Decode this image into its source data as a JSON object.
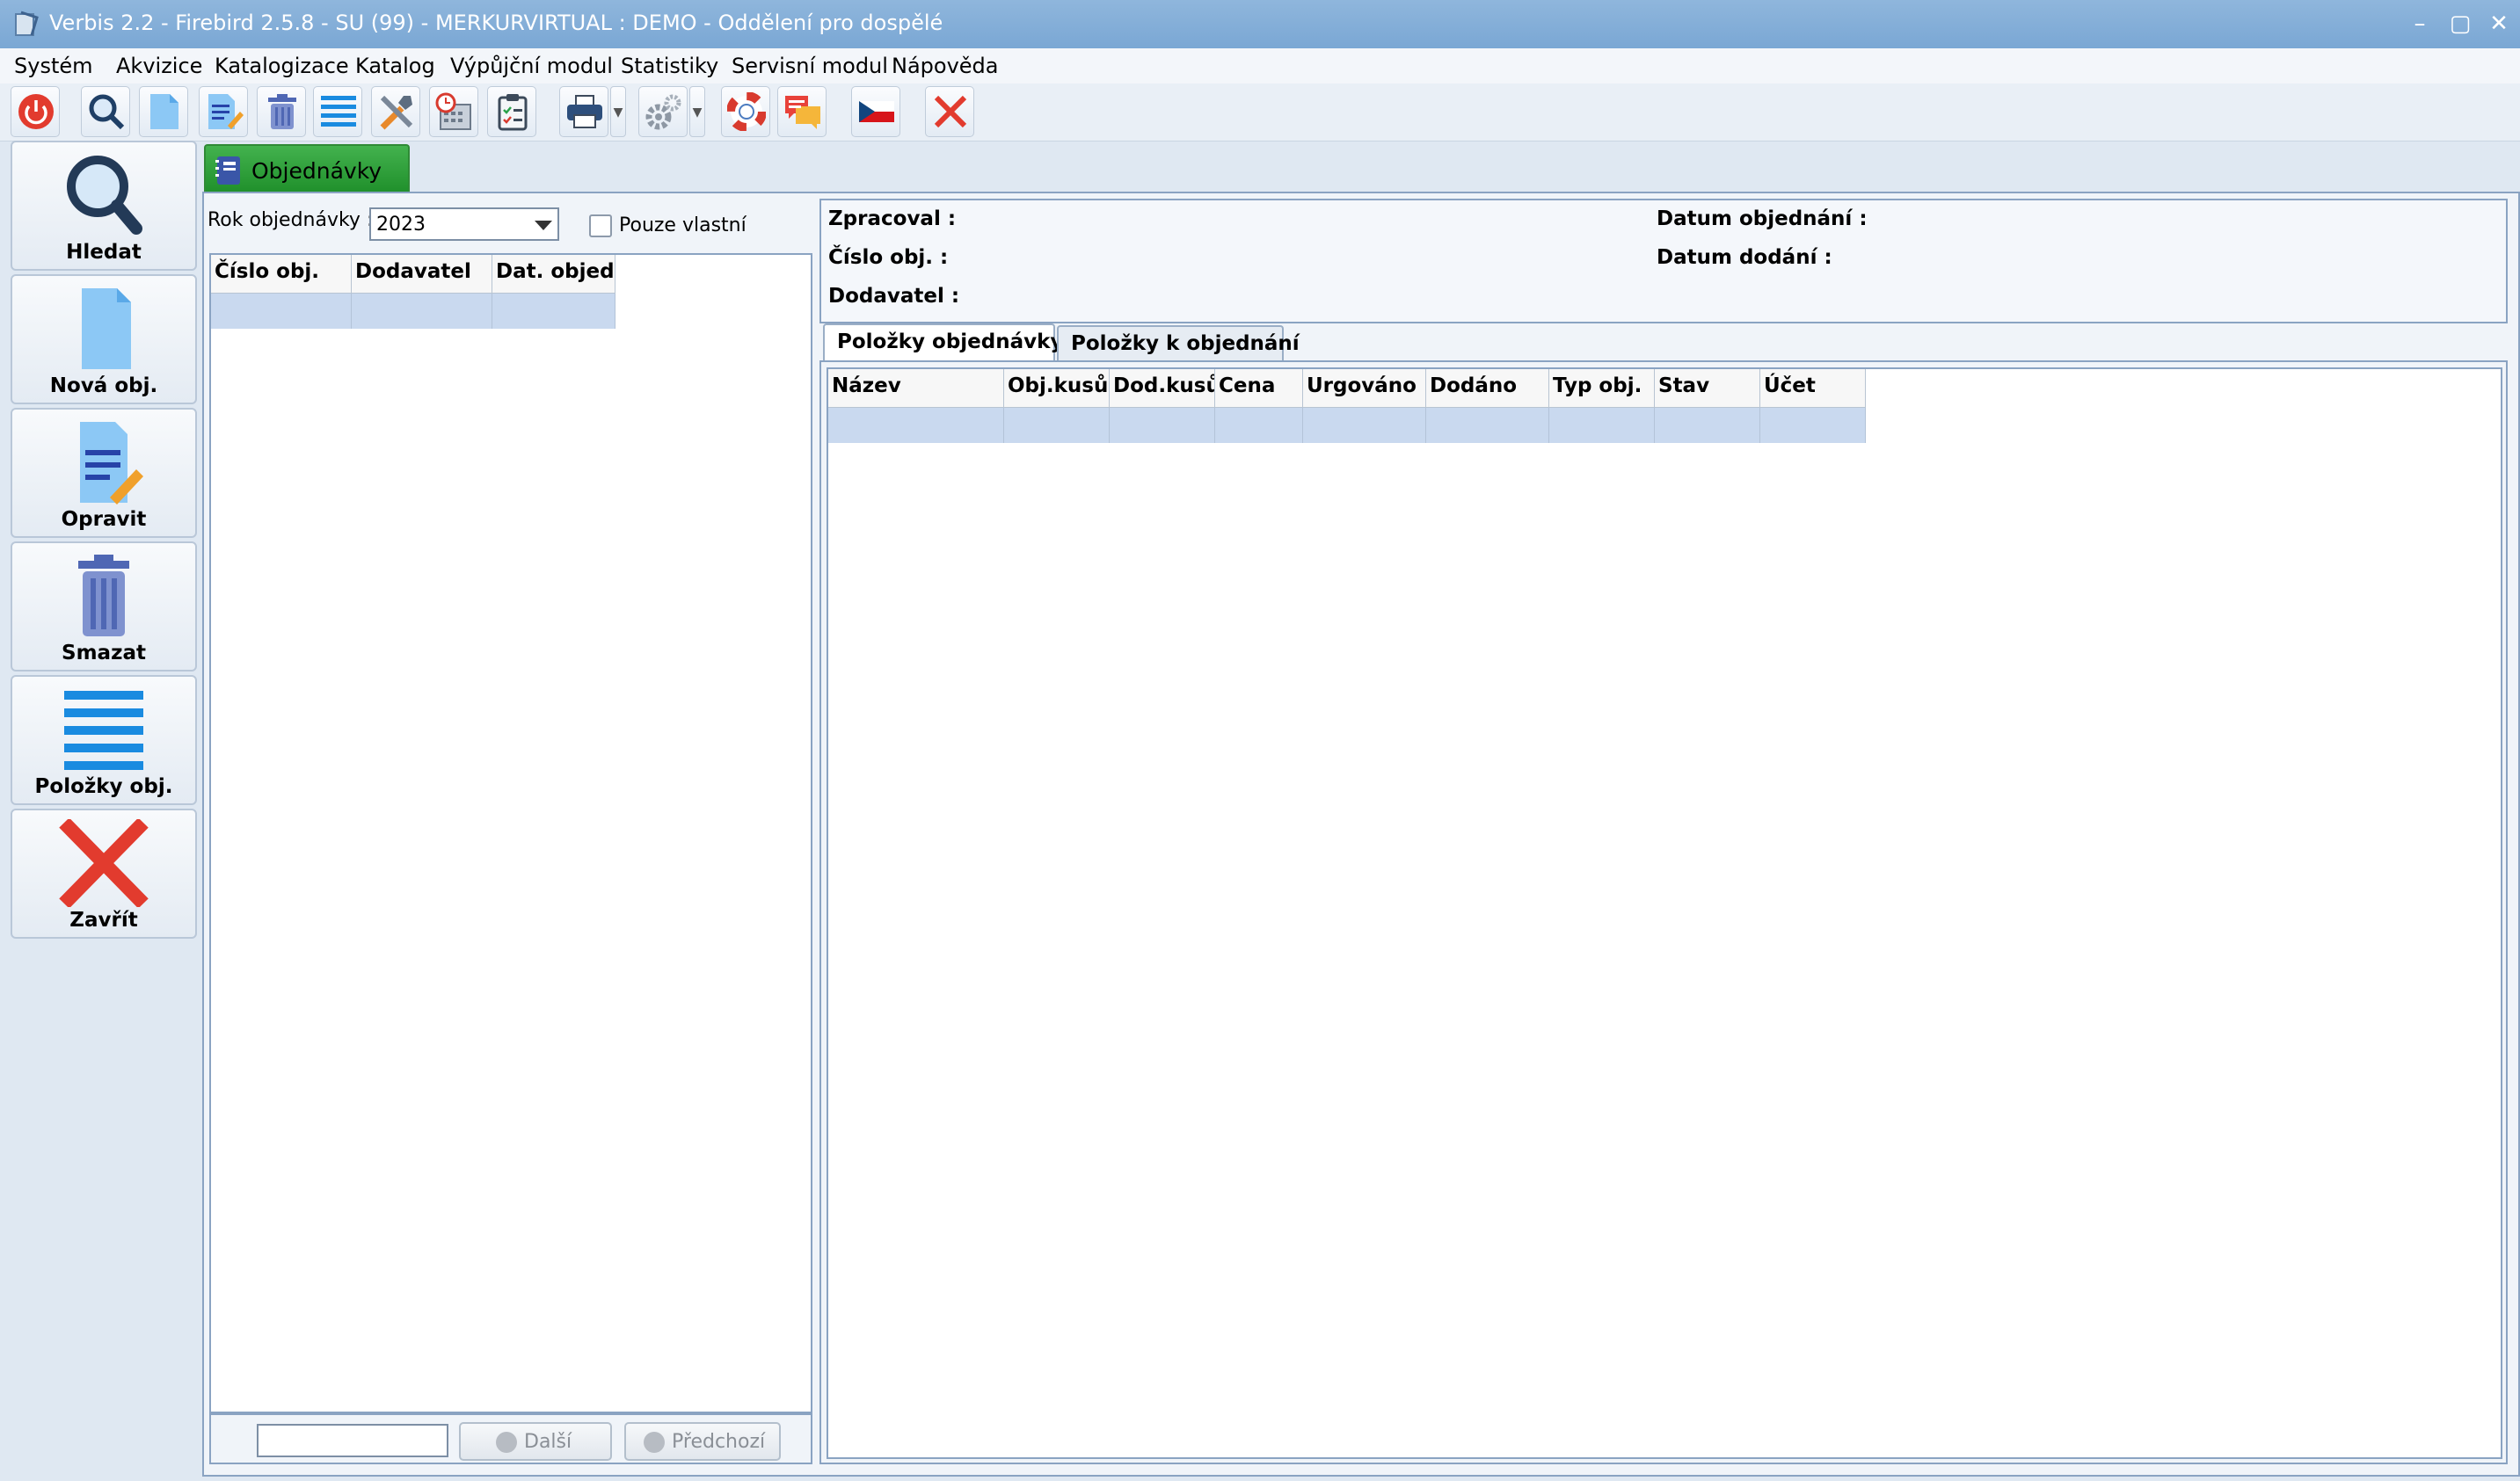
{
  "window": {
    "title": "Verbis 2.2 - Firebird 2.5.8 - SU (99) - MERKURVIRTUAL : DEMO - Oddělení pro dospělé",
    "controls": [
      "minimize",
      "maximize",
      "close"
    ]
  },
  "menu": [
    "Systém",
    "Akvizice",
    "Katalogizace",
    "Katalog",
    "Výpůjční modul",
    "Statistiky",
    "Servisní modul",
    "Nápověda"
  ],
  "toolbar": {
    "icons": [
      "power-icon",
      "search-icon",
      "new-document-icon",
      "edit-document-icon",
      "trash-icon",
      "list-icon",
      "tools-icon",
      "calendar-clock-icon",
      "checklist-icon",
      "printer-icon",
      "settings-gear-icon",
      "help-lifebuoy-icon",
      "chat-icon",
      "czech-flag-icon",
      "close-icon"
    ]
  },
  "sidebar": {
    "buttons": [
      {
        "label": "Hledat",
        "icon": "magnifier-icon"
      },
      {
        "label": "Nová obj.",
        "icon": "new-document-icon"
      },
      {
        "label": "Opravit",
        "icon": "edit-document-icon"
      },
      {
        "label": "Smazat",
        "icon": "trash-icon"
      },
      {
        "label": "Položky obj.",
        "icon": "list-icon"
      },
      {
        "label": "Zavřít",
        "icon": "red-x-icon"
      }
    ]
  },
  "main_tab": {
    "label": "Objednávky"
  },
  "filter": {
    "year_label": "Rok objednávky :",
    "year_value": "2023",
    "own_only_label": "Pouze vlastní"
  },
  "orders_table": {
    "columns": [
      "Číslo obj.",
      "Dodavatel",
      "Dat. objed."
    ],
    "rows": [
      [
        "",
        "",
        ""
      ]
    ]
  },
  "pager": {
    "next_label": "Další",
    "prev_label": "Předchozí"
  },
  "details": {
    "processed_by_label": "Zpracoval :",
    "order_number_label": "Číslo obj. :",
    "supplier_label": "Dodavatel :",
    "order_date_label": "Datum objednání :",
    "delivery_date_label": "Datum dodání :"
  },
  "detail_tabs": [
    "Položky objednávky",
    "Položky k objednání"
  ],
  "items_table": {
    "columns": [
      "Název",
      "Obj.kusů",
      "Dod.kusů",
      "Cena",
      "Urgováno",
      "Dodáno",
      "Typ obj.",
      "Stav",
      "Účet"
    ],
    "rows": [
      [
        "",
        "",
        "",
        "",
        "",
        "",
        "",
        "",
        ""
      ]
    ]
  },
  "colors": {
    "titlebar": "#7aa7d4",
    "active_tab": "#2f9a3a",
    "selection_row": "#c9d9ef",
    "close_red": "#e23b2e"
  }
}
